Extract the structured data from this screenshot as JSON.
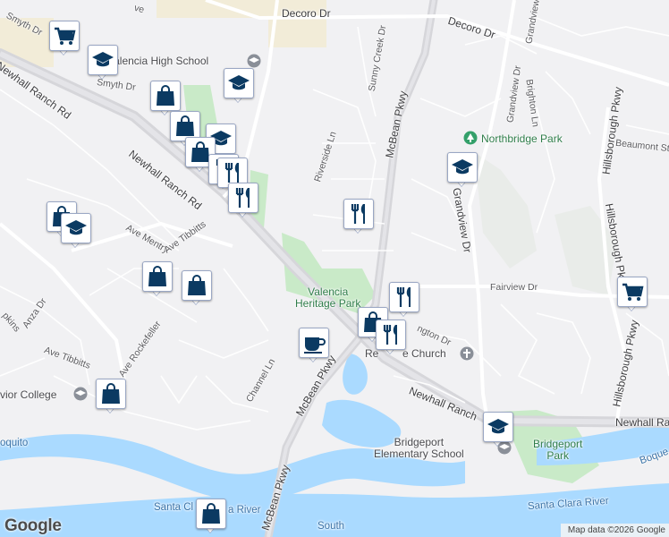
{
  "map": {
    "roads": {
      "smyth_dr_1": "Smyth Dr",
      "smyth_dr_2": "Smyth Dr",
      "avenue_top": "ve",
      "decoro_dr_1": "Decoro Dr",
      "decoro_dr_2": "Decoro Dr",
      "newhall_ranch_rd_1": "Newhall Ranch Rd",
      "newhall_ranch_rd_2": "Newhall Ranch Rd",
      "newhall_ranch_rd_3": "Newhall Ranch",
      "newhall_ranch_rd_4": "Newhall Ra",
      "mcbean_pkwy_1": "McBean Pkwy",
      "mcbean_pkwy_2": "McBean Pkwy",
      "mcbean_pkwy_3": "McBean Pkwy",
      "riverside_ln": "Riverside Ln",
      "sunny_creek_dr": "Sunny Creek Dr",
      "grandview_dr_1": "Grandview Dr",
      "grandview_dr_2": "Grandview Dr",
      "grandview_dr_3": "Grandview Dr",
      "brighton_ln": "Brighton Ln",
      "hillsborough_pkwy_1": "Hillsborough Pkwy",
      "hillsborough_pkwy_2": "Hillsborough Pkwy",
      "hillsborough_pkwy_3": "Hillsborough Pkwy",
      "beaumont_st": "Beaumont St",
      "fairview_dr": "Fairview Dr",
      "ave_mentry": "Ave Mentry",
      "ave_tibbitts_1": "Ave Tibbitts",
      "ave_tibbitts_2": "Ave Tibbitts",
      "anza_dr": "Anza Dr",
      "hopkins": "pkins",
      "ave_rockefeller": "Ave Rockefeller",
      "channel_ln": "Channel Ln",
      "arlington_rd": "ngton Dr",
      "boquito_1": "oquito",
      "boquito_2": "Boque"
    },
    "places": {
      "valencia_high_school": "Valencia High School",
      "northbridge_park": "Northbridge Park",
      "valencia_heritage_park": "Valencia\nHeritage Park",
      "church": "Re        e Church",
      "bridgeport_elementary": "Bridgeport\nElementary School",
      "bridgeport_park": "Bridgeport\nPark",
      "college": "vior College",
      "south": "South"
    },
    "water": {
      "santa_clara_river_1": "Santa Cl",
      "santa_clara_river_1b": "a River",
      "santa_clara_river_2": "Santa Clara River"
    },
    "colors": {
      "land": "#f1f1f3",
      "park": "#c9eac8",
      "water": "#aadaff",
      "highway": "#d9d9dd",
      "pin_icon": "#0b3a62"
    },
    "markers": [
      {
        "icon": "shopping-cart-icon"
      },
      {
        "icon": "school-icon"
      },
      {
        "icon": "school-icon"
      },
      {
        "icon": "shopping-bag-icon"
      },
      {
        "icon": "shopping-bag-icon"
      },
      {
        "icon": "school-icon"
      },
      {
        "icon": "shopping-bag-icon"
      },
      {
        "icon": "restaurant-icon"
      },
      {
        "icon": "restaurant-icon"
      },
      {
        "icon": "restaurant-icon"
      },
      {
        "icon": "shopping-bag-icon"
      },
      {
        "icon": "school-icon"
      },
      {
        "icon": "shopping-bag-icon"
      },
      {
        "icon": "shopping-bag-icon"
      },
      {
        "icon": "school-icon"
      },
      {
        "icon": "restaurant-icon"
      },
      {
        "icon": "restaurant-icon"
      },
      {
        "icon": "shopping-bag-icon"
      },
      {
        "icon": "restaurant-icon"
      },
      {
        "icon": "cafe-icon"
      },
      {
        "icon": "shopping-bag-icon"
      },
      {
        "icon": "shopping-cart-icon"
      },
      {
        "icon": "school-icon"
      },
      {
        "icon": "shopping-bag-icon"
      }
    ]
  },
  "branding": {
    "google": "Google",
    "map_data": "Map data ©2026 Google"
  }
}
